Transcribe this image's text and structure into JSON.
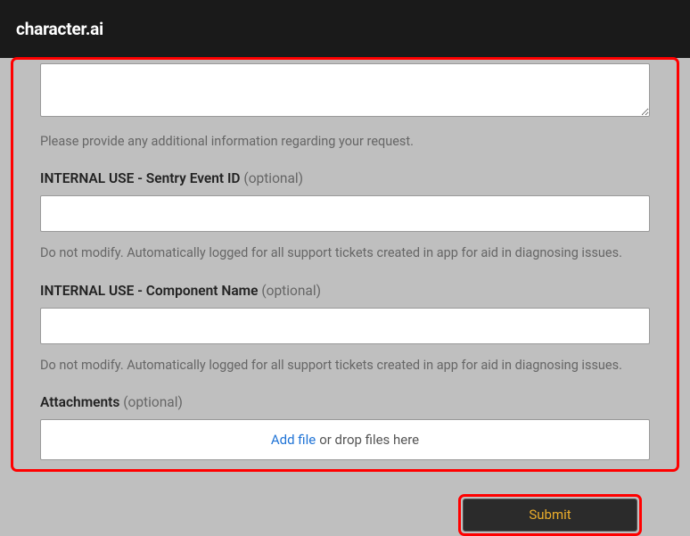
{
  "header": {
    "logo": "character.ai"
  },
  "form": {
    "description": {
      "help_text": "Please provide any additional information regarding your request."
    },
    "sentry": {
      "label": "INTERNAL USE - Sentry Event ID",
      "optional": "(optional)",
      "help_text": "Do not modify. Automatically logged for all support tickets created in app for aid in diagnosing issues."
    },
    "component": {
      "label": "INTERNAL USE - Component Name",
      "optional": "(optional)",
      "help_text": "Do not modify. Automatically logged for all support tickets created in app for aid in diagnosing issues."
    },
    "attachments": {
      "label": "Attachments",
      "optional": "(optional)",
      "add_file": "Add file",
      "drop_text": "or drop files here"
    },
    "submit_label": "Submit"
  }
}
